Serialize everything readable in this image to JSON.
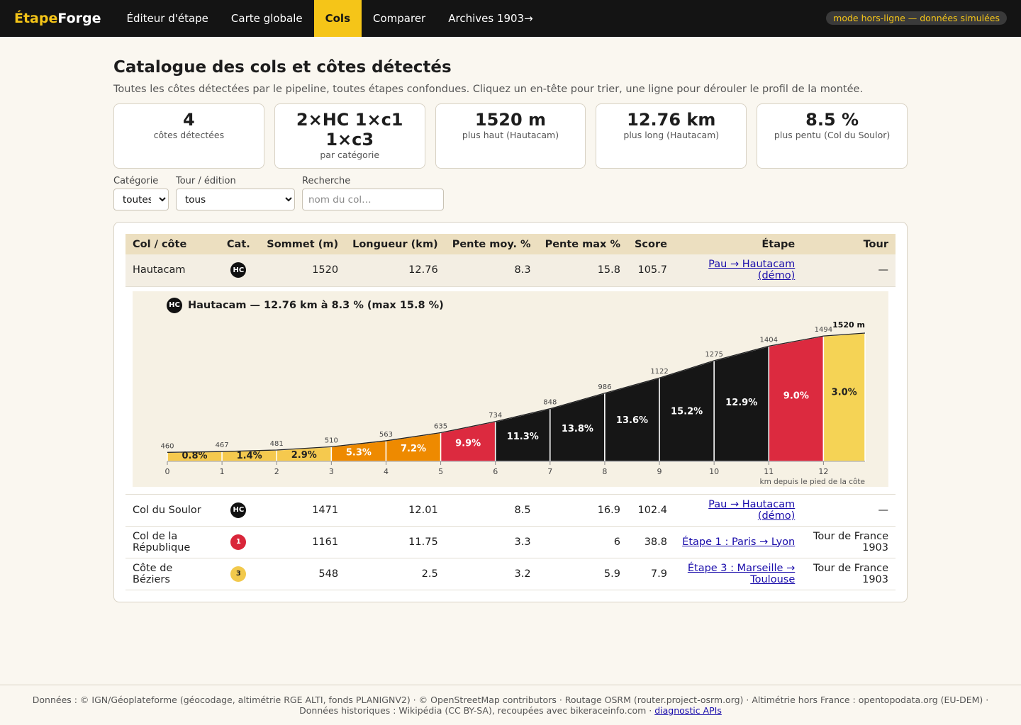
{
  "brand": {
    "part1": "Étape",
    "part2": "Forge"
  },
  "nav": [
    {
      "label": "Éditeur d'étape",
      "active": false
    },
    {
      "label": "Carte globale",
      "active": false
    },
    {
      "label": "Cols",
      "active": true
    },
    {
      "label": "Comparer",
      "active": false
    },
    {
      "label": "Archives 1903→",
      "active": false
    }
  ],
  "offline_badge": "mode hors-ligne — données simulées",
  "page": {
    "title": "Catalogue des cols et côtes détectés",
    "subtitle": "Toutes les côtes détectées par le pipeline, toutes étapes confondues. Cliquez un en-tête pour trier, une ligne pour dérouler le profil de la montée."
  },
  "stats": [
    {
      "value": "4",
      "label": "côtes détectées"
    },
    {
      "value": "2×HC 1×c1 1×c3",
      "label": "par catégorie"
    },
    {
      "value": "1520 m",
      "label": "plus haut (Hautacam)"
    },
    {
      "value": "12.76 km",
      "label": "plus long (Hautacam)"
    },
    {
      "value": "8.5 %",
      "label": "plus pentu (Col du Soulor)"
    }
  ],
  "filters": {
    "category_label": "Catégorie",
    "category_value": "toutes",
    "tour_label": "Tour / édition",
    "tour_value": "tous",
    "search_label": "Recherche",
    "search_placeholder": "nom du col…"
  },
  "table": {
    "headers": [
      "Col / côte",
      "Cat.",
      "Sommet (m)",
      "Longueur (km)",
      "Pente moy. %",
      "Pente max %",
      "Score",
      "Étape",
      "Tour"
    ],
    "rows": [
      {
        "name": "Hautacam",
        "cat": "HC",
        "summit": "1520",
        "length": "12.76",
        "avg": "8.3",
        "max": "15.8",
        "score": "105.7",
        "stage": "Pau → Hautacam (démo)",
        "tour": "—"
      },
      {
        "name": "Col du Soulor",
        "cat": "HC",
        "summit": "1471",
        "length": "12.01",
        "avg": "8.5",
        "max": "16.9",
        "score": "102.4",
        "stage": "Pau → Hautacam (démo)",
        "tour": "—"
      },
      {
        "name": "Col de la République",
        "cat": "1",
        "summit": "1161",
        "length": "11.75",
        "avg": "3.3",
        "max": "6",
        "score": "38.8",
        "stage": "Étape 1 : Paris → Lyon",
        "tour": "Tour de France 1903"
      },
      {
        "name": "Côte de Béziers",
        "cat": "3",
        "summit": "548",
        "length": "2.5",
        "avg": "3.2",
        "max": "5.9",
        "score": "7.9",
        "stage": "Étape 3 : Marseille → Toulouse",
        "tour": "Tour de France 1903"
      }
    ]
  },
  "profile": {
    "badge": "HC",
    "title": "Hautacam — 12.76 km à 8.3 % (max 15.8 %)",
    "summit_label": "1520 m",
    "xlabel": "km depuis le pied de la côte"
  },
  "chart_data": {
    "type": "area",
    "title": "Hautacam — 12.76 km à 8.3 % (max 15.8 %)",
    "xlabel": "km depuis le pied de la côte",
    "ylabel": "",
    "x": [
      0,
      1,
      2,
      3,
      4,
      5,
      6,
      7,
      8,
      9,
      10,
      11,
      12,
      12.76
    ],
    "elevation": [
      460,
      467,
      481,
      510,
      563,
      635,
      734,
      848,
      986,
      1122,
      1275,
      1404,
      1494,
      1520
    ],
    "segment_grades": [
      "0.8%",
      "1.4%",
      "2.9%",
      "5.3%",
      "7.2%",
      "9.9%",
      "11.3%",
      "13.8%",
      "13.6%",
      "15.2%",
      "12.9%",
      "9.0%",
      "3.0%"
    ],
    "segment_colors": [
      "#f5c94e",
      "#f5c94e",
      "#f5c94e",
      "#ee8a00",
      "#ee8a00",
      "#dc2a3f",
      "#161616",
      "#161616",
      "#161616",
      "#161616",
      "#161616",
      "#dc2a3f",
      "#f5d355"
    ],
    "xticks": [
      "0",
      "1",
      "2",
      "3",
      "4",
      "5",
      "6",
      "7",
      "8",
      "9",
      "10",
      "11",
      "12"
    ],
    "xlim": [
      0,
      12.76
    ],
    "ylim": [
      380,
      1520
    ]
  },
  "footer": {
    "text": "Données : © IGN/Géoplateforme (géocodage, altimétrie RGE ALTI, fonds PLANIGNV2) · © OpenStreetMap contributors · Routage OSRM (router.project-osrm.org) · Altimétrie hors France : opentopodata.org (EU-DEM) · Données historiques : Wikipédia (CC BY-SA), recoupées avec bikeraceinfo.com · ",
    "link": "diagnostic APIs"
  }
}
